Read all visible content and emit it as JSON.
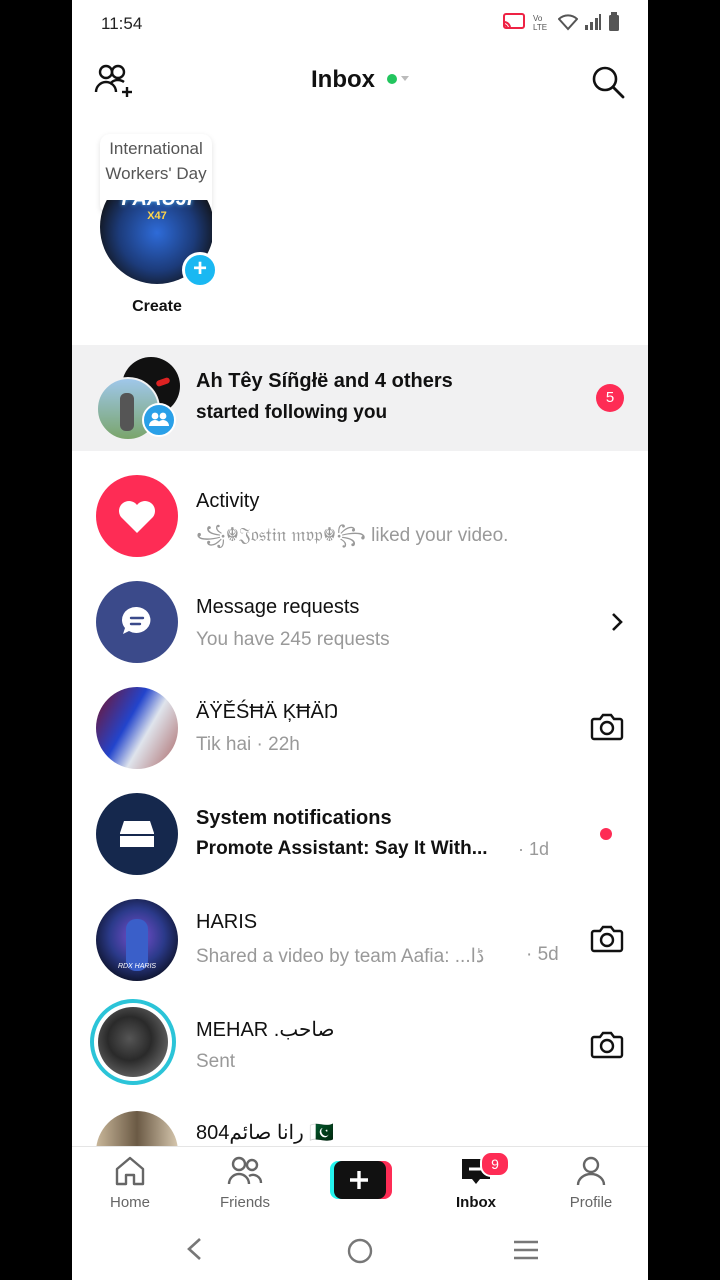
{
  "status_bar": {
    "time": "11:54"
  },
  "header": {
    "title": "Inbox"
  },
  "story": {
    "bubble_text": "International Workers' Day",
    "avatar_text": "FAAUJI",
    "avatar_subtext": "X47",
    "label": "Create"
  },
  "rows": [
    {
      "title": "Ah Têy Síñgłë and 4 others",
      "subtitle": "started following you",
      "badge": "5"
    },
    {
      "title": "Activity",
      "subtitle": "꧁☬𝔍𝔬𝔰𝔱𝔦𝔫 𝔪𝔳𝔭☬꧂ liked your video."
    },
    {
      "title": "Message requests",
      "subtitle": "You have 245 requests"
    },
    {
      "title": "ÄŸĚŚĦÄ ĶĦÄŊ",
      "subtitle": "Tik hai · 22h"
    },
    {
      "title": "System notifications",
      "subtitle": "Promote Assistant: Say It With...",
      "time": "· 1d"
    },
    {
      "title": "HARIS",
      "subtitle": "Shared a video by team Aafia: ...ڈا",
      "time": "· 5d"
    },
    {
      "title": "MEHAR .صاحب",
      "subtitle": "Sent"
    },
    {
      "title": "804رانا صائم 🇵🇰"
    }
  ],
  "bottom_nav": {
    "home": "Home",
    "friends": "Friends",
    "inbox": "Inbox",
    "inbox_badge": "9",
    "profile": "Profile"
  },
  "colors": {
    "accent": "#fe2c55",
    "activity": "#fe2c55",
    "requests": "#3b4a8a",
    "online": "#22c55e"
  }
}
